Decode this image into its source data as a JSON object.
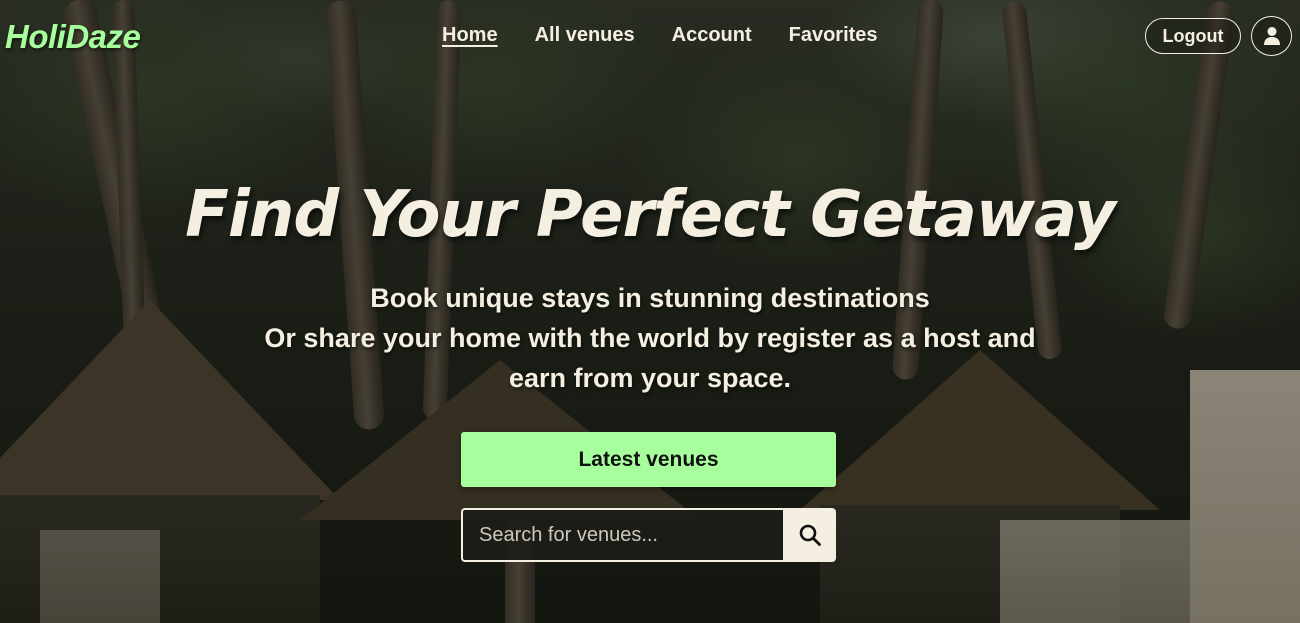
{
  "brand": {
    "name": "HoliDaze",
    "accent": "#a6ff9c",
    "text_color": "#f5efe2"
  },
  "nav": {
    "items": [
      {
        "label": "Home",
        "active": true
      },
      {
        "label": "All venues",
        "active": false
      },
      {
        "label": "Account",
        "active": false
      },
      {
        "label": "Favorites",
        "active": false
      }
    ]
  },
  "header": {
    "logout_label": "Logout",
    "avatar_icon": "user-icon"
  },
  "hero": {
    "title": "Find Your Perfect Getaway",
    "subtitle_lines": [
      "Book unique stays in stunning destinations",
      "Or share your home with the world by register as a host and",
      "earn from your space."
    ],
    "cta_label": "Latest venues"
  },
  "search": {
    "placeholder": "Search for venues...",
    "value": "",
    "button_icon": "search-icon"
  }
}
